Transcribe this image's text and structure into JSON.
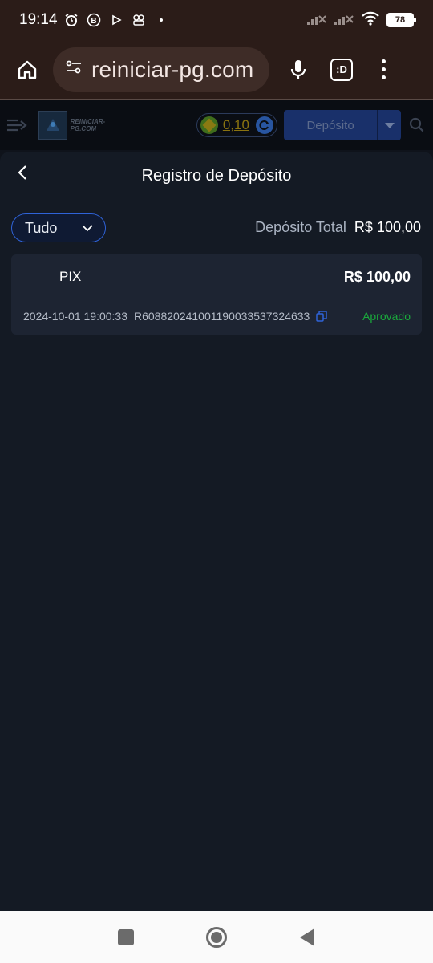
{
  "status_bar": {
    "time": "19:14",
    "battery": "78",
    "icons": [
      "alarm-icon",
      "b-badge-icon",
      "play-icon",
      "puzzle-icon",
      "dot-icon",
      "signal-icon",
      "signal-icon",
      "wifi-icon",
      "battery-icon"
    ]
  },
  "browser": {
    "url": "reiniciar-pg.com",
    "tabs_label": ":D"
  },
  "site_header": {
    "logo_text": "REINICIAR-PG.COM",
    "balance": "0,10",
    "deposit_button": "Depósito"
  },
  "page": {
    "title": "Registro de Depósito",
    "filter_value": "Tudo",
    "total_label": "Depósito Total",
    "total_value": "R$ 100,00"
  },
  "records": [
    {
      "method": "PIX",
      "amount": "R$ 100,00",
      "datetime": "2024-10-01 19:00:33",
      "id": "R6088202410011900335373246 33",
      "status": "Aprovado"
    }
  ],
  "colors": {
    "status_bar_bg": "#2b1c18",
    "panel_bg": "#141a24",
    "card_bg": "#1d2432",
    "accent_blue": "#2f63d8",
    "status_green": "#1aaa3c"
  }
}
